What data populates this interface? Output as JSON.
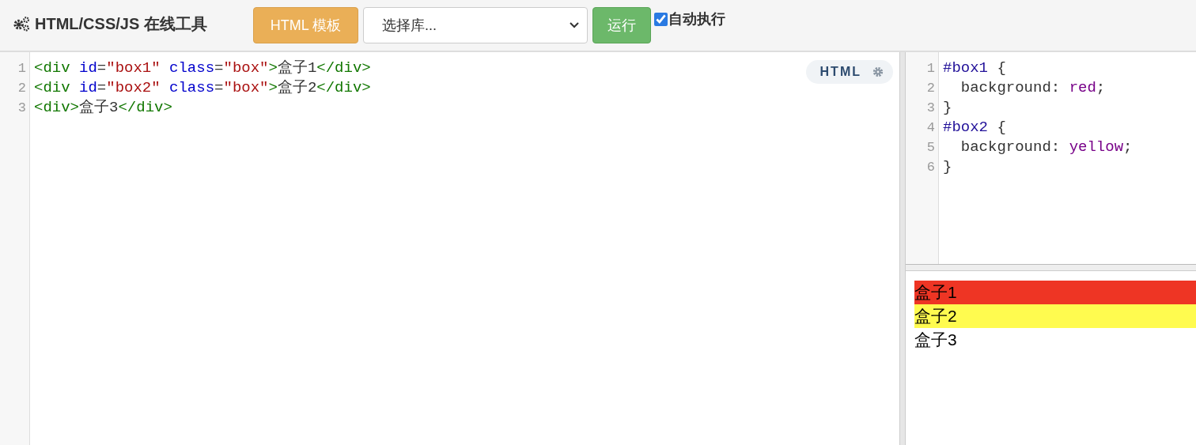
{
  "header": {
    "title": "HTML/CSS/JS 在线工具",
    "template_button": "HTML 模板",
    "library_select": {
      "value": "选择库..."
    },
    "run_button": "运行",
    "auto_run": {
      "label": "自动执行",
      "checked": true
    }
  },
  "html_editor": {
    "badge": "HTML",
    "lines": [
      [
        {
          "kind": "tag",
          "text": "<div"
        },
        {
          "kind": "attr",
          "text": " id"
        },
        {
          "kind": "plain",
          "text": "="
        },
        {
          "kind": "string",
          "text": "\"box1\""
        },
        {
          "kind": "attr",
          "text": " class"
        },
        {
          "kind": "plain",
          "text": "="
        },
        {
          "kind": "string",
          "text": "\"box\""
        },
        {
          "kind": "tag",
          "text": ">"
        },
        {
          "kind": "plain",
          "text": "盒子1"
        },
        {
          "kind": "tag",
          "text": "</div>"
        }
      ],
      [
        {
          "kind": "tag",
          "text": "<div"
        },
        {
          "kind": "attr",
          "text": " id"
        },
        {
          "kind": "plain",
          "text": "="
        },
        {
          "kind": "string",
          "text": "\"box2\""
        },
        {
          "kind": "attr",
          "text": " class"
        },
        {
          "kind": "plain",
          "text": "="
        },
        {
          "kind": "string",
          "text": "\"box\""
        },
        {
          "kind": "tag",
          "text": ">"
        },
        {
          "kind": "plain",
          "text": "盒子2"
        },
        {
          "kind": "tag",
          "text": "</div>"
        }
      ],
      [
        {
          "kind": "tag",
          "text": "<div>"
        },
        {
          "kind": "plain",
          "text": "盒子3"
        },
        {
          "kind": "tag",
          "text": "</div>"
        }
      ]
    ],
    "line_numbers": [
      "1",
      "2",
      "3"
    ]
  },
  "css_editor": {
    "lines": [
      [
        {
          "kind": "selector",
          "text": "#box1"
        },
        {
          "kind": "plain",
          "text": " {"
        }
      ],
      [
        {
          "kind": "plain",
          "text": "  background: "
        },
        {
          "kind": "value",
          "text": "red"
        },
        {
          "kind": "plain",
          "text": ";"
        }
      ],
      [
        {
          "kind": "plain",
          "text": "}"
        }
      ],
      [
        {
          "kind": "selector",
          "text": "#box2"
        },
        {
          "kind": "plain",
          "text": " {"
        }
      ],
      [
        {
          "kind": "plain",
          "text": "  background: "
        },
        {
          "kind": "value",
          "text": "yellow"
        },
        {
          "kind": "plain",
          "text": ";"
        }
      ],
      [
        {
          "kind": "plain",
          "text": "}"
        }
      ]
    ],
    "line_numbers": [
      "1",
      "2",
      "3",
      "4",
      "5",
      "6"
    ]
  },
  "output": {
    "boxes": [
      {
        "text": "盒子1",
        "color": "#ee3524"
      },
      {
        "text": "盒子2",
        "color": "#fffb4f"
      },
      {
        "text": "盒子3"
      }
    ]
  }
}
